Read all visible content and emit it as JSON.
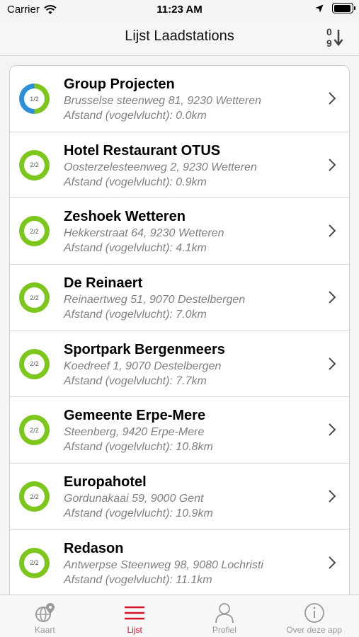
{
  "status_bar": {
    "carrier": "Carrier",
    "time": "11:23 AM",
    "battery_level": 0.95
  },
  "nav": {
    "title": "Lijst Laadstations",
    "sort_icon": "sort-numeric-down-icon"
  },
  "colors": {
    "available": "#7dc61e",
    "occupied": "#2d8fd8",
    "accent": "#d6122b",
    "ring_track": "#7dc61e"
  },
  "stations": [
    {
      "name": "Group Projecten",
      "address": "Brusselse steenweg 81, 9230 Wetteren",
      "distance": "Afstand (vogelvlucht): 0.0km",
      "availability": "1/2",
      "available_fraction": 0.5
    },
    {
      "name": "Hotel Restaurant OTUS",
      "address": "Oosterzelesteenweg 2, 9230 Wetteren",
      "distance": "Afstand (vogelvlucht): 0.9km",
      "availability": "2/2",
      "available_fraction": 1
    },
    {
      "name": "Zeshoek Wetteren",
      "address": "Hekkerstraat 64, 9230 Wetteren",
      "distance": "Afstand (vogelvlucht): 4.1km",
      "availability": "2/2",
      "available_fraction": 1
    },
    {
      "name": "De Reinaert",
      "address": "Reinaertweg 51, 9070 Destelbergen",
      "distance": "Afstand (vogelvlucht): 7.0km",
      "availability": "2/2",
      "available_fraction": 1
    },
    {
      "name": "Sportpark Bergenmeers",
      "address": "Koedreef 1, 9070 Destelbergen",
      "distance": "Afstand (vogelvlucht): 7.7km",
      "availability": "2/2",
      "available_fraction": 1
    },
    {
      "name": "Gemeente Erpe-Mere",
      "address": "Steenberg, 9420 Erpe-Mere",
      "distance": "Afstand (vogelvlucht): 10.8km",
      "availability": "2/2",
      "available_fraction": 1
    },
    {
      "name": "Europahotel",
      "address": "Gordunakaai 59, 9000 Gent",
      "distance": "Afstand (vogelvlucht): 10.9km",
      "availability": "2/2",
      "available_fraction": 1
    },
    {
      "name": "Redason",
      "address": "Antwerpse Steenweg 98, 9080 Lochristi",
      "distance": "Afstand (vogelvlucht): 11.1km",
      "availability": "2/2",
      "available_fraction": 1
    }
  ],
  "tabs": [
    {
      "label": "Kaart",
      "icon": "globe-pin-icon",
      "active": false
    },
    {
      "label": "Lijst",
      "icon": "list-icon",
      "active": true
    },
    {
      "label": "Profiel",
      "icon": "person-icon",
      "active": false
    },
    {
      "label": "Over deze app",
      "icon": "info-icon",
      "active": false
    }
  ]
}
